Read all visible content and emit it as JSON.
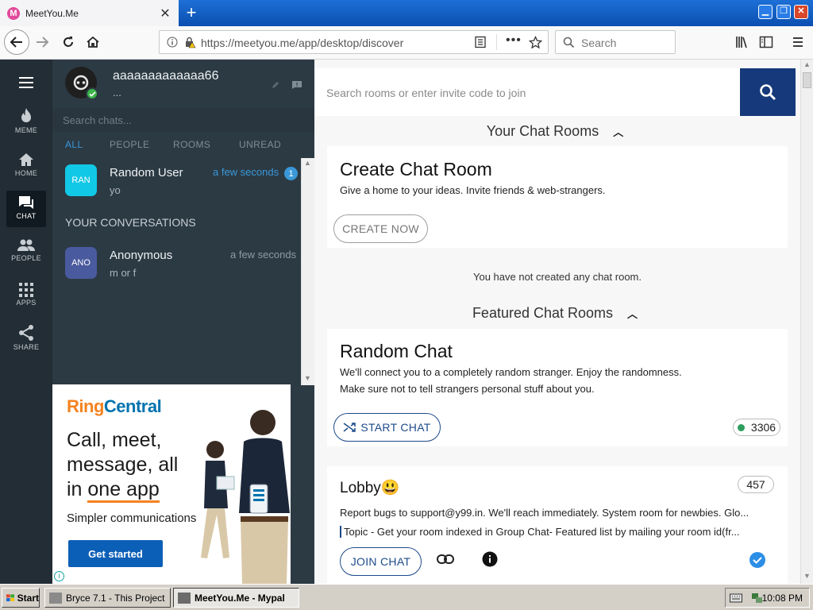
{
  "browser": {
    "tab_title": "MeetYou.Me",
    "favicon_letter": "M",
    "url": "https://meetyou.me/app/desktop/discover",
    "search_placeholder": "Search"
  },
  "user": {
    "name": "aaaaaaaaaaaaa66",
    "status": "..."
  },
  "rail": [
    {
      "label": "MEME",
      "icon": "fire-icon"
    },
    {
      "label": "HOME",
      "icon": "home-icon"
    },
    {
      "label": "CHAT",
      "icon": "chat-icon"
    },
    {
      "label": "PEOPLE",
      "icon": "people-icon"
    },
    {
      "label": "APPS",
      "icon": "apps-grid-icon"
    },
    {
      "label": "SHARE",
      "icon": "share-icon"
    }
  ],
  "chat_list": {
    "search_placeholder": "Search chats...",
    "filters": [
      "ALL",
      "PEOPLE",
      "ROOMS",
      "UNREAD"
    ],
    "top": {
      "avatar": "RAN",
      "name": "Random User",
      "message": "yo",
      "time": "a few seconds",
      "unread": "1"
    },
    "section_title": "YOUR CONVERSATIONS",
    "conversations": [
      {
        "avatar": "ANO",
        "name": "Anonymous",
        "message": "m or f",
        "time": "a few seconds"
      }
    ]
  },
  "ad": {
    "brand_ring": "Ring",
    "brand_central": "Central",
    "headline_1": "Call, meet,",
    "headline_2": "message, all",
    "headline_3a": "in ",
    "headline_3b": "one app",
    "subline": "Simpler communications",
    "cta": "Get started"
  },
  "discover": {
    "search_placeholder": "Search rooms or enter invite code to join",
    "your_rooms_title": "Your Chat Rooms",
    "create": {
      "title": "Create Chat Room",
      "desc": "Give a home to your ideas. Invite friends & web-strangers.",
      "button": "CREATE NOW"
    },
    "empty_text": "You have not created any chat room.",
    "featured_title": "Featured Chat Rooms",
    "random": {
      "title": "Random Chat",
      "desc_1": "We'll connect you to a completely random stranger. Enjoy the randomness.",
      "desc_2": "Make sure not to tell strangers personal stuff about you.",
      "button": "START CHAT",
      "online": "3306"
    },
    "lobby": {
      "title": "Lobby",
      "emoji": "😃",
      "count": "457",
      "desc": "Report bugs to support@y99.in. We'll reach immediately. System room for newbies. Glo...",
      "topic": "Topic - Get your room indexed in Group Chat- Featured list by mailing your room id(fr...",
      "button": "JOIN CHAT"
    }
  },
  "taskbar": {
    "start": "Start",
    "items": [
      "Bryce 7.1 - This Project",
      "MeetYou.Me - Mypal"
    ],
    "clock": "10:08 PM"
  },
  "colors": {
    "rail_bg": "#222d35",
    "panel_bg": "#2c3a44",
    "accent_blue": "#3a98d8",
    "search_btn": "#15397a",
    "ringcentral_orange": "#f58220",
    "ringcentral_blue": "#0073ae"
  }
}
